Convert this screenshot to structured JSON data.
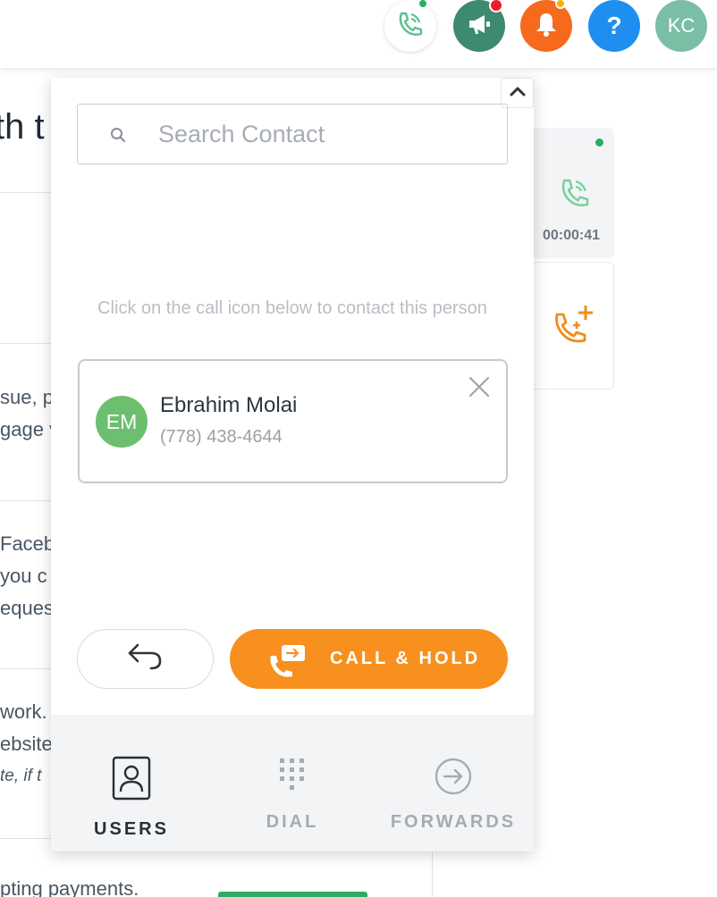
{
  "topbar": {
    "avatar_initials": "KC",
    "help_label": "?",
    "icons": [
      "phone-call-icon",
      "megaphone-icon",
      "bell-icon",
      "help-icon"
    ],
    "colors": {
      "announce": "#3d8a6f",
      "bell": "#f56a1c",
      "help": "#1f8ef1",
      "avatar": "#7abfa5"
    }
  },
  "background": {
    "heading_fragment": "th t",
    "text_lines": [
      "sue, p",
      "gage v",
      "Faceb",
      "you c",
      "eques",
      "work. I",
      "ebsite",
      "te, if t",
      "pting payments."
    ],
    "active_call_timer": "00:00:41"
  },
  "panel": {
    "search": {
      "placeholder": "Search Contact",
      "value": ""
    },
    "hint": "Click on the call icon below to contact this person",
    "contact": {
      "initials": "EM",
      "name": "Ebrahim Molai",
      "phone": "(778) 438-4644"
    },
    "call_hold_label": "CALL & HOLD",
    "accent_color": "#f7901e",
    "tabs": [
      {
        "label": "USERS",
        "icon": "user-badge-icon",
        "active": true
      },
      {
        "label": "DIAL",
        "icon": "dialpad-icon",
        "active": false
      },
      {
        "label": "FORWARDS",
        "icon": "forward-arrow-icon",
        "active": false
      }
    ]
  }
}
